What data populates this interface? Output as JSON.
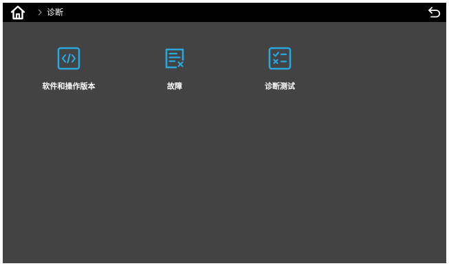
{
  "header": {
    "home_icon": "home-icon",
    "separator_icon": "chevron-right-icon",
    "breadcrumb_label": "诊断",
    "back_icon": "return-icon"
  },
  "tiles": [
    {
      "label": "软件和操作版本",
      "icon": "code-icon"
    },
    {
      "label": "故障",
      "icon": "fault-list-icon"
    },
    {
      "label": "诊断测试",
      "icon": "checklist-icon"
    }
  ],
  "colors": {
    "accent": "#29a8e0",
    "header_bg": "#000000",
    "content_bg": "#434343",
    "text": "#ffffff"
  }
}
